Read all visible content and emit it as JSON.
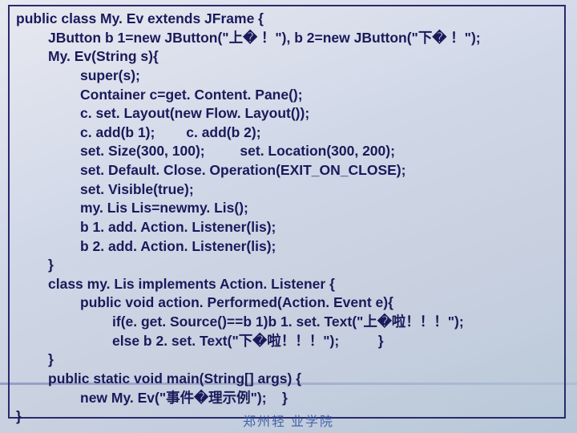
{
  "code": {
    "l01": "public class My. Ev extends JFrame {",
    "l02": "JButton b 1=new JButton(\"上� ！\"), b 2=new JButton(\"下� ！\");",
    "l03": "My. Ev(String s){",
    "l04": "super(s);",
    "l05": "Container c=get. Content. Pane();",
    "l06": "c. set. Layout(new Flow. Layout());",
    "l07": "c. add(b 1);        c. add(b 2);",
    "l08": "set. Size(300, 100);         set. Location(300, 200);",
    "l09": "set. Default. Close. Operation(EXIT_ON_CLOSE);",
    "l10": "set. Visible(true);",
    "l11": "my. Lis Lis=newmy. Lis();",
    "l12": "b 1. add. Action. Listener(lis);",
    "l13": "b 2. add. Action. Listener(lis);",
    "l14": "}",
    "l15": "class my. Lis implements Action. Listener {",
    "l16": "public void action. Performed(Action. Event e){",
    "l17": "if(e. get. Source()==b 1)b 1. set. Text(\"上�啦！！！\");",
    "l18": "else b 2. set. Text(\"下�啦！！！\");          }",
    "l19": "}",
    "l20": "public static void main(String[] args) {",
    "l21": "new My. Ev(\"事件�理示例\");    }",
    "l22": "}"
  },
  "footer": "郑州轻 业学院"
}
